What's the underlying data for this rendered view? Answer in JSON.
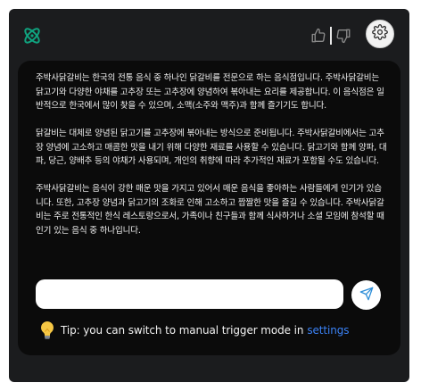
{
  "header": {
    "logo_icon": "openai-logo-icon",
    "accent": "#10a37f",
    "thumbs_up_icon": "thumbs-up-icon",
    "thumbs_down_icon": "thumbs-down-icon",
    "settings_icon": "gear-icon"
  },
  "message": {
    "paragraphs": [
      "주박사닭갈비는 한국의 전통 음식 중 하나인 닭갈비를 전문으로 하는 음식점입니다. 주박사닭갈비는 닭고기와 다양한 야채를 고추장 또는 고추장에 양념하여 볶아내는 요리를 제공합니다. 이 음식점은 일반적으로 한국에서 많이 찾을 수 있으며, 소맥(소주와 맥주)과 함께 즐기기도 합니다.",
      "닭갈비는 대체로 양념된 닭고기를 고추장에 볶아내는 방식으로 준비됩니다. 주박사닭갈비에서는 고추장 양념에 고소하고 매콤한 맛을 내기 위해 다양한 재료를 사용할 수 있습니다. 닭고기와 함께 양파, 대파, 당근, 양배추 등의 야채가 사용되며, 개인의 취향에 따라 추가적인 재료가 포함될 수도 있습니다.",
      "주박사닭갈비는 음식이 강한 매운 맛을 가지고 있어서 매운 음식을 좋아하는 사람들에게 인기가 있습니다. 또한, 고추장 양념과 닭고기의 조화로 인해 고소하고 짭짤한 맛을 즐길 수 있습니다. 주박사닭갈비는 주로 전통적인 한식 레스토랑으로서, 가족이나 친구들과 함께 식사하거나 소셜 모임에 참석할 때 인기 있는 음식 중 하나입니다."
    ]
  },
  "composer": {
    "input_value": "",
    "input_placeholder": "",
    "send_icon": "send-icon"
  },
  "tip": {
    "icon": "lightbulb-icon",
    "text": "Tip: you can switch to manual trigger mode in",
    "link": "settings",
    "link_color": "#3b82f6"
  }
}
